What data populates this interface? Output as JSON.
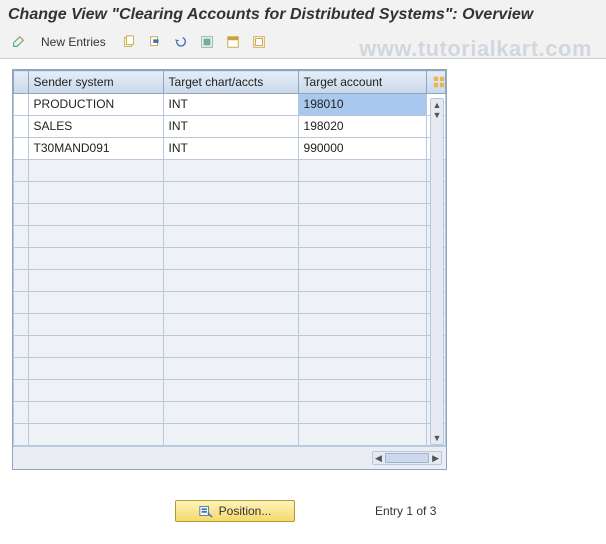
{
  "title": "Change View \"Clearing Accounts for Distributed Systems\": Overview",
  "toolbar": {
    "new_entries_label": "New Entries"
  },
  "table": {
    "headers": {
      "sender_system": "Sender system",
      "target_chart": "Target chart/accts",
      "target_account": "Target account"
    },
    "rows": [
      {
        "sender": "PRODUCTION",
        "chart": "INT",
        "account": "198010"
      },
      {
        "sender": "SALES",
        "chart": "INT",
        "account": "198020"
      },
      {
        "sender": "T30MAND091",
        "chart": "INT",
        "account": "990000"
      }
    ],
    "empty_row_count": 13
  },
  "footer": {
    "position_label": "Position...",
    "entry_text": "Entry 1 of 3"
  },
  "watermark": "www.tutorialkart.com"
}
